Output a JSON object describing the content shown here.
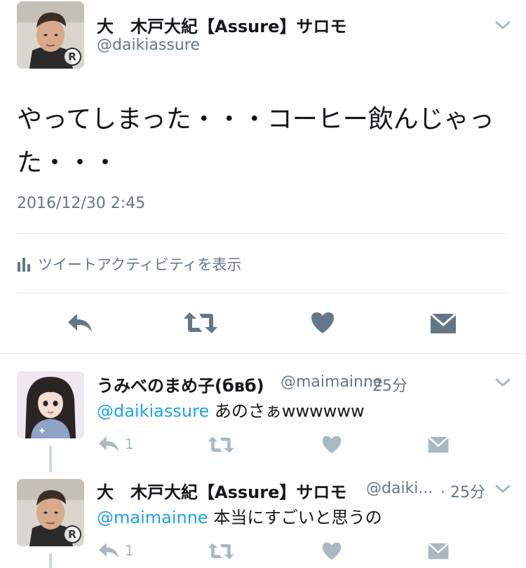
{
  "main_tweet": {
    "display_name": "大　木戸大紀【Assure】サロモ",
    "handle": "@daikiassure",
    "text": "やってしまった・・・コーヒー飲んじゃった・・・",
    "timestamp": "2016/12/30 2:45",
    "activity_label": "ツイートアクティビティを表示",
    "avatar_badge": "R"
  },
  "replies": [
    {
      "display_name": "うみべのまめ子(бвб)",
      "handle": "@maimainne",
      "time": "· 25分",
      "mention": "@daikiassure",
      "text": " あのさぁwwwwww",
      "reply_count": "1"
    },
    {
      "display_name": "大　木戸大紀【Assure】サロモ",
      "handle": "@daiki...",
      "time": "· 25分",
      "mention": "@maimainne",
      "text": " 本当にすごいと思うの",
      "reply_count": "1",
      "avatar_badge": "R"
    }
  ],
  "colors": {
    "accent": "#1da1f2",
    "muted": "#657786",
    "icon_dark": "#657786",
    "icon_light": "#aab8c2",
    "divider": "#e1e8ed"
  },
  "icons": [
    "chevron-down-icon",
    "bar-chart-icon",
    "reply-icon",
    "retweet-icon",
    "heart-icon",
    "mail-icon"
  ]
}
